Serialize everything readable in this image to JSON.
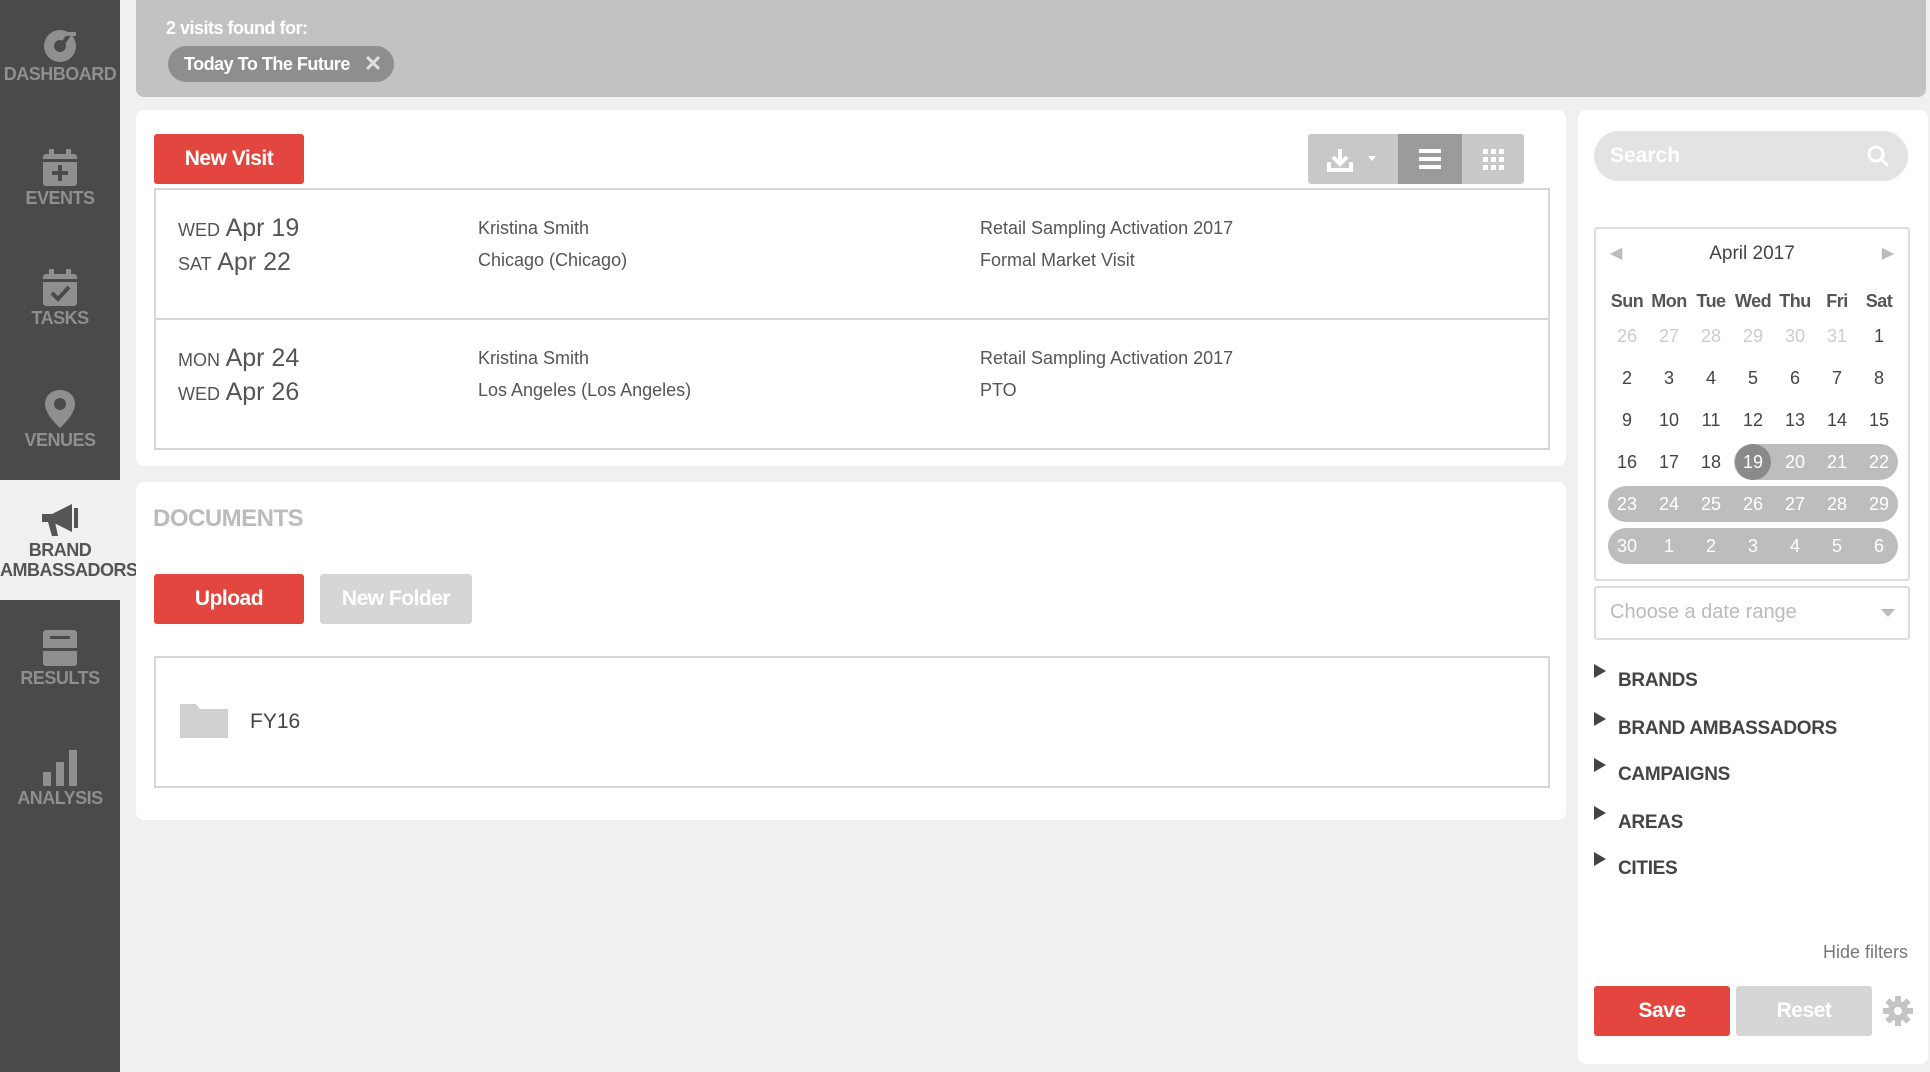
{
  "nav": [
    {
      "label": "DASHBOARD",
      "icon": "dashboard-gauge-icon"
    },
    {
      "label": "EVENTS",
      "icon": "calendar-plus-icon"
    },
    {
      "label": "TASKS",
      "icon": "calendar-check-icon"
    },
    {
      "label": "VENUES",
      "icon": "map-pin-icon"
    },
    {
      "label_line1": "BRAND",
      "label_line2": "AMBASSADORS",
      "icon": "megaphone-icon",
      "active": true
    },
    {
      "label": "RESULTS",
      "icon": "inbox-tray-icon"
    },
    {
      "label": "ANALYSIS",
      "icon": "bar-chart-icon"
    }
  ],
  "header": {
    "found_text": "2 visits found for:",
    "filter_chip": "Today To The Future",
    "chip_close": "✕"
  },
  "visits_toolbar": {
    "new_visit": "New Visit",
    "download_icon": "download-icon",
    "list_view_icon": "list-view-icon",
    "grid_view_icon": "grid-view-icon"
  },
  "visits": [
    {
      "start_dow": "WED",
      "start_date": "Apr 19",
      "end_dow": "SAT",
      "end_date": "Apr 22",
      "person": "Kristina Smith",
      "location": "Chicago (Chicago)",
      "campaign": "Retail Sampling Activation 2017",
      "type": "Formal Market Visit"
    },
    {
      "start_dow": "MON",
      "start_date": "Apr 24",
      "end_dow": "WED",
      "end_date": "Apr 26",
      "person": "Kristina Smith",
      "location": "Los Angeles (Los Angeles)",
      "campaign": "Retail Sampling Activation 2017",
      "type": "PTO"
    }
  ],
  "documents": {
    "title": "DOCUMENTS",
    "upload": "Upload",
    "new_folder": "New Folder",
    "folders": [
      "FY16"
    ]
  },
  "filters": {
    "search_placeholder": "Search",
    "calendar": {
      "month": "April 2017",
      "prev": "◀",
      "next": "▶",
      "weekdays": [
        "Sun",
        "Mon",
        "Tue",
        "Wed",
        "Thu",
        "Fri",
        "Sat"
      ],
      "weeks": [
        [
          "26",
          "27",
          "28",
          "29",
          "30",
          "31",
          "1"
        ],
        [
          "2",
          "3",
          "4",
          "5",
          "6",
          "7",
          "8"
        ],
        [
          "9",
          "10",
          "11",
          "12",
          "13",
          "14",
          "15"
        ],
        [
          "16",
          "17",
          "18",
          "19",
          "20",
          "21",
          "22"
        ],
        [
          "23",
          "24",
          "25",
          "26",
          "27",
          "28",
          "29"
        ],
        [
          "30",
          "1",
          "2",
          "3",
          "4",
          "5",
          "6"
        ]
      ],
      "selected_day": "19"
    },
    "date_range_placeholder": "Choose a date range",
    "sections": [
      "BRANDS",
      "BRAND AMBASSADORS",
      "CAMPAIGNS",
      "AREAS",
      "CITIES"
    ],
    "hide_filters": "Hide filters",
    "save": "Save",
    "reset": "Reset",
    "settings_icon": "gear-icon"
  },
  "colors": {
    "accent_red": "#e2463f",
    "sidebar_bg": "#4a4a4a",
    "range_band": "#bdbdbd"
  }
}
